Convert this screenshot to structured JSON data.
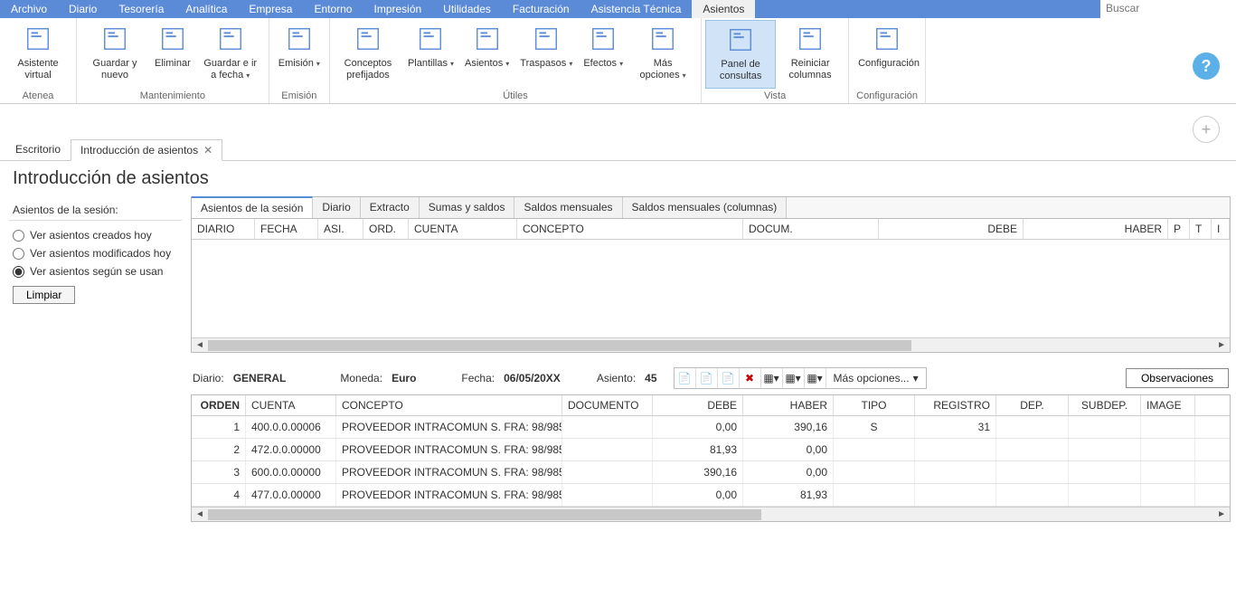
{
  "menu": [
    "Archivo",
    "Diario",
    "Tesorería",
    "Analítica",
    "Empresa",
    "Entorno",
    "Impresión",
    "Utilidades",
    "Facturación",
    "Asistencia Técnica",
    "Asientos"
  ],
  "active_menu_index": 10,
  "search_placeholder": "Buscar",
  "ribbon": {
    "groups": [
      {
        "label": "Atenea",
        "buttons": [
          {
            "label": "Asistente virtual",
            "drop": false
          }
        ]
      },
      {
        "label": "Mantenimiento",
        "buttons": [
          {
            "label": "Guardar y nuevo",
            "drop": false
          },
          {
            "label": "Eliminar",
            "drop": false
          },
          {
            "label": "Guardar e ir a fecha",
            "drop": true
          }
        ]
      },
      {
        "label": "Emisión",
        "buttons": [
          {
            "label": "Emisión",
            "drop": true
          }
        ]
      },
      {
        "label": "Útiles",
        "buttons": [
          {
            "label": "Conceptos prefijados",
            "drop": false
          },
          {
            "label": "Plantillas",
            "drop": true
          },
          {
            "label": "Asientos",
            "drop": true
          },
          {
            "label": "Traspasos",
            "drop": true
          },
          {
            "label": "Efectos",
            "drop": true
          },
          {
            "label": "Más opciones",
            "drop": true
          }
        ]
      },
      {
        "label": "Vista",
        "buttons": [
          {
            "label": "Panel de consultas",
            "drop": false,
            "active": true
          },
          {
            "label": "Reiniciar columnas",
            "drop": false
          }
        ]
      },
      {
        "label": "Configuración",
        "buttons": [
          {
            "label": "Configuración",
            "drop": false
          }
        ]
      }
    ]
  },
  "doc_tabs": [
    {
      "label": "Escritorio",
      "close": false,
      "active": false
    },
    {
      "label": "Introducción de asientos",
      "close": true,
      "active": true
    }
  ],
  "page_title": "Introducción de asientos",
  "sidebar": {
    "title": "Asientos de la sesión:",
    "options": [
      {
        "label": "Ver asientos creados hoy",
        "selected": false
      },
      {
        "label": "Ver asientos modificados hoy",
        "selected": false
      },
      {
        "label": "Ver asientos según se usan",
        "selected": true
      }
    ],
    "clear_btn": "Limpiar"
  },
  "inner_tabs": [
    "Asientos de la sesión",
    "Diario",
    "Extracto",
    "Sumas y saldos",
    "Saldos mensuales",
    "Saldos mensuales (columnas)"
  ],
  "inner_active_index": 0,
  "top_grid_columns": [
    "DIARIO",
    "FECHA",
    "ASI.",
    "ORD.",
    "CUENTA",
    "CONCEPTO",
    "DOCUM.",
    "DEBE",
    "HABER",
    "P",
    "T",
    "I"
  ],
  "detail": {
    "diario_label": "Diario:",
    "diario_value": "GENERAL",
    "moneda_label": "Moneda:",
    "moneda_value": "Euro",
    "fecha_label": "Fecha:",
    "fecha_value": "06/05/20XX",
    "asiento_label": "Asiento:",
    "asiento_value": "45",
    "more_label": "Más opciones...",
    "obs_btn": "Observaciones"
  },
  "detail_columns": [
    "ORDEN",
    "CUENTA",
    "CONCEPTO",
    "DOCUMENTO",
    "DEBE",
    "HABER",
    "TIPO",
    "REGISTRO",
    "DEP.",
    "SUBDEP.",
    "IMAGE"
  ],
  "detail_rows": [
    {
      "orden": "1",
      "cuenta": "400.0.0.00006",
      "concepto": "PROVEEDOR INTRACOMUN S. FRA:  98/985",
      "documento": "",
      "debe": "0,00",
      "haber": "390,16",
      "tipo": "S",
      "registro": "31",
      "dep": "",
      "subdep": ""
    },
    {
      "orden": "2",
      "cuenta": "472.0.0.00000",
      "concepto": "PROVEEDOR INTRACOMUN S. FRA:  98/985",
      "documento": "",
      "debe": "81,93",
      "haber": "0,00",
      "tipo": "",
      "registro": "",
      "dep": "",
      "subdep": ""
    },
    {
      "orden": "3",
      "cuenta": "600.0.0.00000",
      "concepto": "PROVEEDOR INTRACOMUN S. FRA:  98/985",
      "documento": "",
      "debe": "390,16",
      "haber": "0,00",
      "tipo": "",
      "registro": "",
      "dep": "",
      "subdep": ""
    },
    {
      "orden": "4",
      "cuenta": "477.0.0.00000",
      "concepto": "PROVEEDOR INTRACOMUN S. FRA:  98/985",
      "documento": "",
      "debe": "0,00",
      "haber": "81,93",
      "tipo": "",
      "registro": "",
      "dep": "",
      "subdep": ""
    }
  ]
}
